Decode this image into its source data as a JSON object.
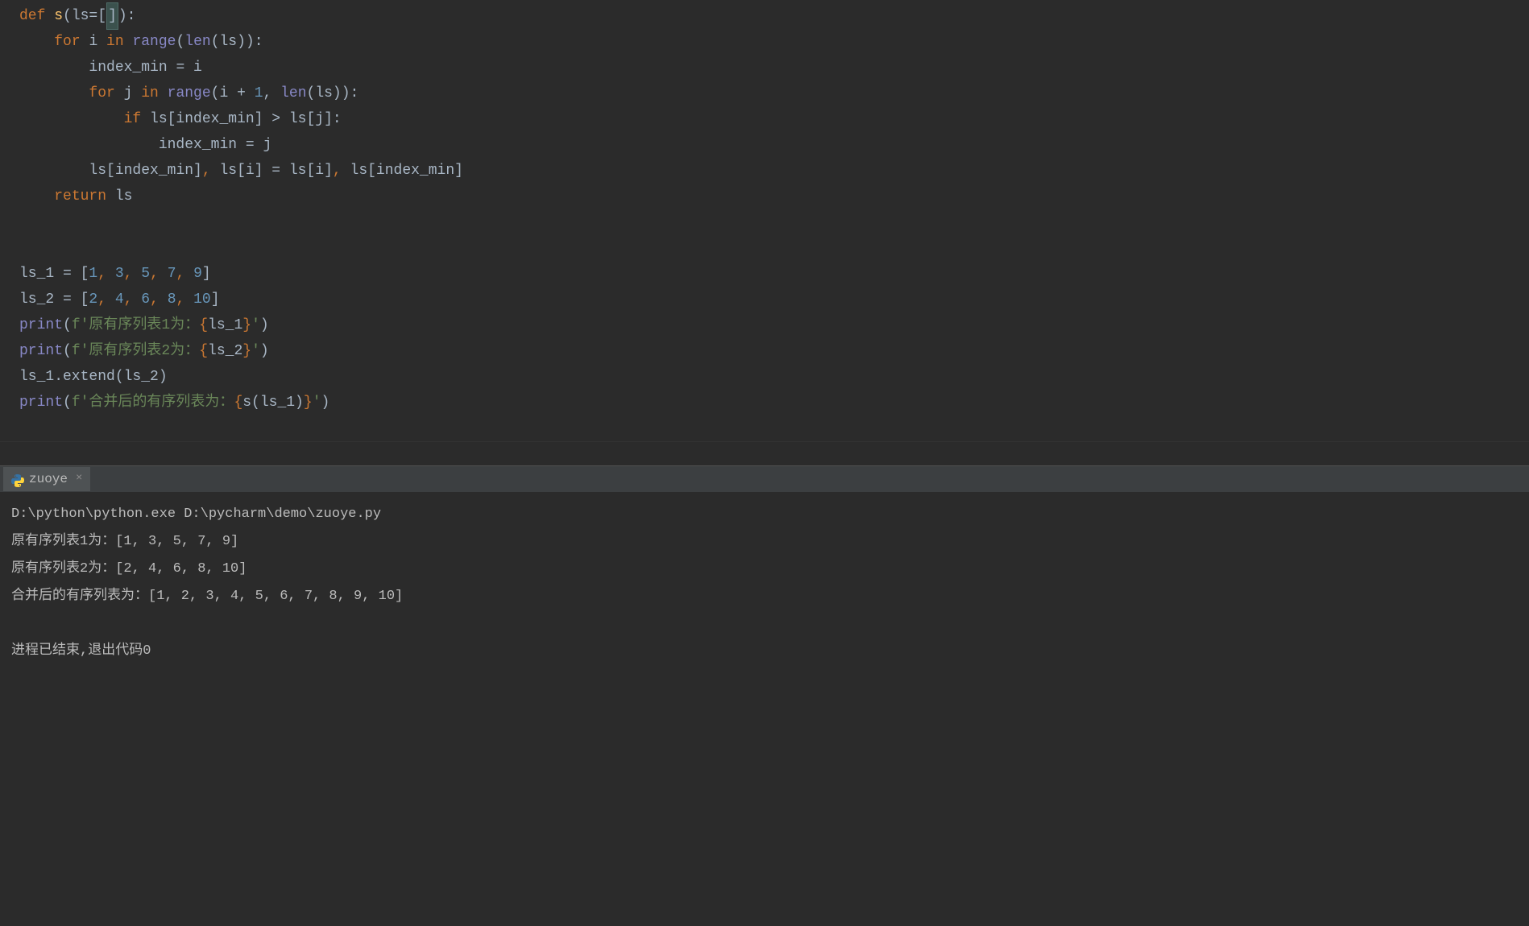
{
  "editor": {
    "lines": [
      {
        "gutter": "",
        "tokens": [
          {
            "t": "def ",
            "c": "kw-def"
          },
          {
            "t": "s",
            "c": "fn-name"
          },
          {
            "t": "(ls=",
            "c": ""
          },
          {
            "t": "[",
            "c": ""
          },
          {
            "t": "]",
            "c": "bracket-hl"
          },
          {
            "t": "):",
            "c": ""
          }
        ]
      },
      {
        "gutter": "",
        "indent": 1,
        "tokens": [
          {
            "t": "for ",
            "c": "kw-orange"
          },
          {
            "t": "i ",
            "c": ""
          },
          {
            "t": "in ",
            "c": "kw-orange"
          },
          {
            "t": "range",
            "c": "builtin"
          },
          {
            "t": "(",
            "c": ""
          },
          {
            "t": "len",
            "c": "builtin"
          },
          {
            "t": "(ls)):",
            "c": ""
          }
        ]
      },
      {
        "gutter": "",
        "indent": 2,
        "tokens": [
          {
            "t": "index_min = i",
            "c": ""
          }
        ]
      },
      {
        "gutter": "",
        "indent": 2,
        "tokens": [
          {
            "t": "for ",
            "c": "kw-orange"
          },
          {
            "t": "j ",
            "c": ""
          },
          {
            "t": "in ",
            "c": "kw-orange"
          },
          {
            "t": "range",
            "c": "builtin"
          },
          {
            "t": "(i + ",
            "c": ""
          },
          {
            "t": "1",
            "c": "num"
          },
          {
            "t": ", ",
            "c": ""
          },
          {
            "t": "len",
            "c": "builtin"
          },
          {
            "t": "(ls)):",
            "c": ""
          }
        ]
      },
      {
        "gutter": "",
        "indent": 3,
        "tokens": [
          {
            "t": "if ",
            "c": "kw-orange"
          },
          {
            "t": "ls[index_min] > ls[j]:",
            "c": ""
          }
        ]
      },
      {
        "gutter": "",
        "indent": 4,
        "tokens": [
          {
            "t": "index_min = j",
            "c": ""
          }
        ]
      },
      {
        "gutter": "",
        "indent": 2,
        "tokens": [
          {
            "t": "ls[index_min]",
            "c": ""
          },
          {
            "t": ", ",
            "c": "kw-orange"
          },
          {
            "t": "ls[i] = ls[i]",
            "c": ""
          },
          {
            "t": ", ",
            "c": "kw-orange"
          },
          {
            "t": "ls[index_min]",
            "c": ""
          }
        ]
      },
      {
        "gutter": "",
        "indent": 1,
        "tokens": [
          {
            "t": "return ",
            "c": "kw-orange"
          },
          {
            "t": "ls",
            "c": ""
          }
        ]
      },
      {
        "gutter": "",
        "tokens": []
      },
      {
        "gutter": "",
        "tokens": []
      },
      {
        "gutter": "",
        "tokens": [
          {
            "t": "ls_1 = [",
            "c": ""
          },
          {
            "t": "1",
            "c": "num"
          },
          {
            "t": ", ",
            "c": "kw-orange"
          },
          {
            "t": "3",
            "c": "num"
          },
          {
            "t": ", ",
            "c": "kw-orange"
          },
          {
            "t": "5",
            "c": "num"
          },
          {
            "t": ", ",
            "c": "kw-orange"
          },
          {
            "t": "7",
            "c": "num"
          },
          {
            "t": ", ",
            "c": "kw-orange"
          },
          {
            "t": "9",
            "c": "num"
          },
          {
            "t": "]",
            "c": ""
          }
        ]
      },
      {
        "gutter": "",
        "tokens": [
          {
            "t": "ls_2 = [",
            "c": ""
          },
          {
            "t": "2",
            "c": "num"
          },
          {
            "t": ", ",
            "c": "kw-orange"
          },
          {
            "t": "4",
            "c": "num"
          },
          {
            "t": ", ",
            "c": "kw-orange"
          },
          {
            "t": "6",
            "c": "num"
          },
          {
            "t": ", ",
            "c": "kw-orange"
          },
          {
            "t": "8",
            "c": "num"
          },
          {
            "t": ", ",
            "c": "kw-orange"
          },
          {
            "t": "10",
            "c": "num"
          },
          {
            "t": "]",
            "c": ""
          }
        ]
      },
      {
        "gutter": "",
        "tokens": [
          {
            "t": "print",
            "c": "builtin"
          },
          {
            "t": "(",
            "c": ""
          },
          {
            "t": "f'原有序列表1为：",
            "c": "str"
          },
          {
            "t": "{",
            "c": "fstr-brace"
          },
          {
            "t": "ls_1",
            "c": ""
          },
          {
            "t": "}",
            "c": "fstr-brace"
          },
          {
            "t": "'",
            "c": "str"
          },
          {
            "t": ")",
            "c": ""
          }
        ]
      },
      {
        "gutter": "",
        "tokens": [
          {
            "t": "print",
            "c": "builtin"
          },
          {
            "t": "(",
            "c": ""
          },
          {
            "t": "f'原有序列表2为：",
            "c": "str"
          },
          {
            "t": "{",
            "c": "fstr-brace"
          },
          {
            "t": "ls_2",
            "c": ""
          },
          {
            "t": "}",
            "c": "fstr-brace"
          },
          {
            "t": "'",
            "c": "str"
          },
          {
            "t": ")",
            "c": ""
          }
        ]
      },
      {
        "gutter": "",
        "tokens": [
          {
            "t": "ls_1.extend(ls_2)",
            "c": ""
          }
        ]
      },
      {
        "gutter": "",
        "tokens": [
          {
            "t": "print",
            "c": "builtin"
          },
          {
            "t": "(",
            "c": ""
          },
          {
            "t": "f'合并后的有序列表为：",
            "c": "str"
          },
          {
            "t": "{",
            "c": "fstr-brace"
          },
          {
            "t": "s(ls_1)",
            "c": ""
          },
          {
            "t": "}",
            "c": "fstr-brace"
          },
          {
            "t": "'",
            "c": "str"
          },
          {
            "t": ")",
            "c": ""
          }
        ]
      }
    ]
  },
  "run": {
    "tab_name": "zuoye",
    "close_glyph": "×",
    "console_lines": [
      "D:\\python\\python.exe D:\\pycharm\\demo\\zuoye.py",
      "原有序列表1为：[1, 3, 5, 7, 9]",
      "原有序列表2为：[2, 4, 6, 8, 10]",
      "合并后的有序列表为：[1, 2, 3, 4, 5, 6, 7, 8, 9, 10]",
      "",
      "进程已结束,退出代码0"
    ]
  }
}
